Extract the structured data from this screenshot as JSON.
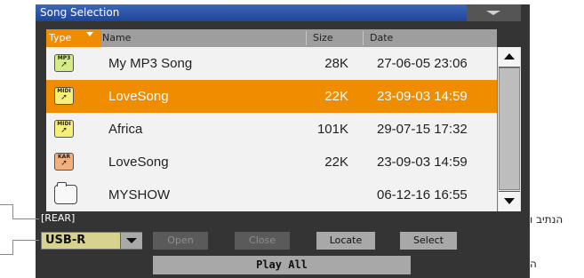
{
  "window": {
    "title": "Song Selection"
  },
  "columns": {
    "type": "Type",
    "name": "Name",
    "size": "Size",
    "date": "Date"
  },
  "files": [
    {
      "icon": "mp3-file-icon",
      "badge": "MP3",
      "name": "My MP3 Song",
      "size": "28K",
      "date": "27-06-05 23:06",
      "selected": false
    },
    {
      "icon": "midi-file-icon",
      "badge": "MIDI",
      "name": "LoveSong",
      "size": "22K",
      "date": "23-09-03 14:59",
      "selected": true
    },
    {
      "icon": "midi-file-icon",
      "badge": "MIDI",
      "name": "Africa",
      "size": "101K",
      "date": "29-07-15 17:32",
      "selected": false
    },
    {
      "icon": "kar-file-icon",
      "badge": "KAR",
      "name": "LoveSong",
      "size": "22K",
      "date": "23-09-03 14:59",
      "selected": false
    },
    {
      "icon": "folder-icon",
      "badge": "",
      "name": "MYSHOW",
      "size": "",
      "date": "06-12-16 16:55",
      "selected": false
    }
  ],
  "path": "[REAR]",
  "device": {
    "value": "USB-R"
  },
  "buttons": {
    "open": "Open",
    "close": "Close",
    "locate": "Locate",
    "select": "Select",
    "play_all": "Play All"
  },
  "annotations": {
    "path_label": "הנתיב ו",
    "device_label": "ה"
  },
  "colors": {
    "selection": "#f08c00",
    "title_bar": "#2a52a8",
    "screen_bg": "#343434"
  }
}
